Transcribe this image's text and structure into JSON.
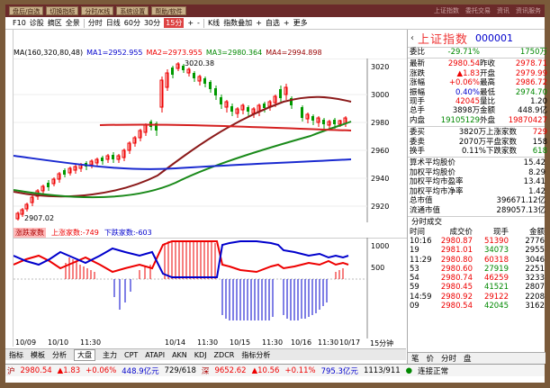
{
  "topmenu": {
    "buttons": [
      "盘后/自选",
      "切换指标",
      "分时/K线",
      "系统设置",
      "帮助/软件"
    ],
    "items": [
      "上证指数",
      "委托交易",
      "资讯",
      "资讯服务"
    ]
  },
  "toolbar": {
    "items": [
      "F10",
      "诊股",
      "摘区",
      "全景",
      "分时",
      "日线",
      "60分",
      "30分",
      "15分",
      "+",
      "-",
      "K线",
      "指数叠加",
      "+",
      "自选",
      "+",
      "更多"
    ],
    "active": "15分"
  },
  "ma": {
    "label": "MA",
    "params": "(160,320,80,48)",
    "ma1": "MA1=2952.955",
    "ma2": "MA2=2973.955",
    "ma3": "MA3=2980.364",
    "ma4": "MA4=2994.898"
  },
  "chart": {
    "yticks": [
      "3020",
      "3000",
      "2980",
      "2960",
      "2940",
      "2920"
    ],
    "high_label": "3020.38",
    "low_label": "2907.02"
  },
  "indicator": {
    "name": "涨跌家数",
    "up": "上涨家数:-749",
    "down": "下跌家数:-603",
    "yticks": [
      "1000",
      "500"
    ]
  },
  "xaxis": [
    "10/09",
    "10/10",
    "11:30",
    "10/14",
    "11:30",
    "10/15",
    "11:30",
    "10/16",
    "11:30",
    "10/17"
  ],
  "xaxis_suffix": "15分钟",
  "tabs": [
    "指标",
    "模板",
    "分析",
    "大盘",
    "主力",
    "CPT",
    "ATAPI",
    "AKN",
    "KDJ",
    "ZDCR",
    "指标分析"
  ],
  "tabs_active": "大盘",
  "right": {
    "name": "上证指数",
    "code": "000001",
    "row_wb": {
      "l1": "委比",
      "v1": "-29.71%",
      "l2": "",
      "v2": "1750万"
    },
    "rows": [
      {
        "l1": "最新",
        "v1": "2980.54",
        "l2": "昨收",
        "v2": "2978.71",
        "c1": "red",
        "c2": "red"
      },
      {
        "l1": "涨跌",
        "v1": "▲1.83",
        "l2": "开盘",
        "v2": "2979.99",
        "c1": "red",
        "c2": "red"
      },
      {
        "l1": "涨幅",
        "v1": "+0.06%",
        "l2": "最高",
        "v2": "2986.72",
        "c1": "red",
        "c2": "red"
      },
      {
        "l1": "振幅",
        "v1": "0.40%",
        "l2": "最低",
        "v2": "2974.70",
        "c1": "blu",
        "c2": "grn"
      },
      {
        "l1": "现手",
        "v1": "42045",
        "l2": "量比",
        "v2": "1.20",
        "c1": "red",
        "c2": ""
      },
      {
        "l1": "总手",
        "v1": "3898万",
        "l2": "金额",
        "v2": "448.9亿",
        "c1": "",
        "c2": ""
      },
      {
        "l1": "内盘",
        "v1": "19105129",
        "l2": "外盘",
        "v2": "19870427",
        "c1": "grn",
        "c2": "red"
      }
    ],
    "stats": [
      {
        "l1": "委买",
        "v1": "3820万",
        "l2": "上涨家数",
        "v2": "729",
        "c1": "",
        "c2": "red"
      },
      {
        "l1": "委卖",
        "v1": "2070万",
        "l2": "平盘家数",
        "v2": "158",
        "c1": "",
        "c2": ""
      },
      {
        "l1": "换手",
        "v1": "0.11%",
        "l2": "下跌家数",
        "v2": "618",
        "c1": "",
        "c2": "grn"
      }
    ],
    "avg": [
      {
        "l": "算术平均股价",
        "v": "15.42"
      },
      {
        "l": "加权平均股价",
        "v": "8.29"
      },
      {
        "l": "加权平均市盈率",
        "v": "13.41"
      },
      {
        "l": "加权平均市净率",
        "v": "1.42"
      },
      {
        "l": "总市值",
        "v": "396671.12亿"
      },
      {
        "l": "流通市值",
        "v": "289057.13亿"
      }
    ],
    "ticks_title": "分时成交",
    "tick_headers": [
      "时间",
      "成交价",
      "现手",
      "金额"
    ],
    "ticks": [
      {
        "t": "10:16",
        "p": "2980.87",
        "v": "51390",
        "a": "2776"
      },
      {
        "t": "19",
        "p": "2981.01",
        "v": "34073",
        "a": "2955"
      },
      {
        "t": "11:29",
        "p": "2980.80",
        "v": "60318",
        "a": "3046"
      },
      {
        "t": "53",
        "p": "2980.60",
        "v": "27919",
        "a": "2251"
      },
      {
        "t": "54",
        "p": "2980.74",
        "v": "46259",
        "a": "3233"
      },
      {
        "t": "59",
        "p": "2980.45",
        "v": "41521",
        "a": "2807"
      },
      {
        "t": "14:59",
        "p": "2980.92",
        "v": "29122",
        "a": "2208"
      },
      {
        "t": "09",
        "p": "2980.54",
        "v": "42045",
        "a": "3162"
      }
    ],
    "bottom_tabs": [
      "笔",
      "价",
      "分时",
      "盘"
    ]
  },
  "status": {
    "sh_label": "沪",
    "sh_price": "2980.54",
    "sh_chg": "▲1.83",
    "sh_pct": "+0.06%",
    "sh_amt": "448.9亿元",
    "sh_updown": "729/618",
    "sz_label": "深",
    "sz_price": "9652.62",
    "sz_chg": "▲10.56",
    "sz_pct": "+0.11%",
    "sz_amt": "795.3亿元",
    "sz_updown": "1113/911",
    "conn": "连接正常"
  }
}
